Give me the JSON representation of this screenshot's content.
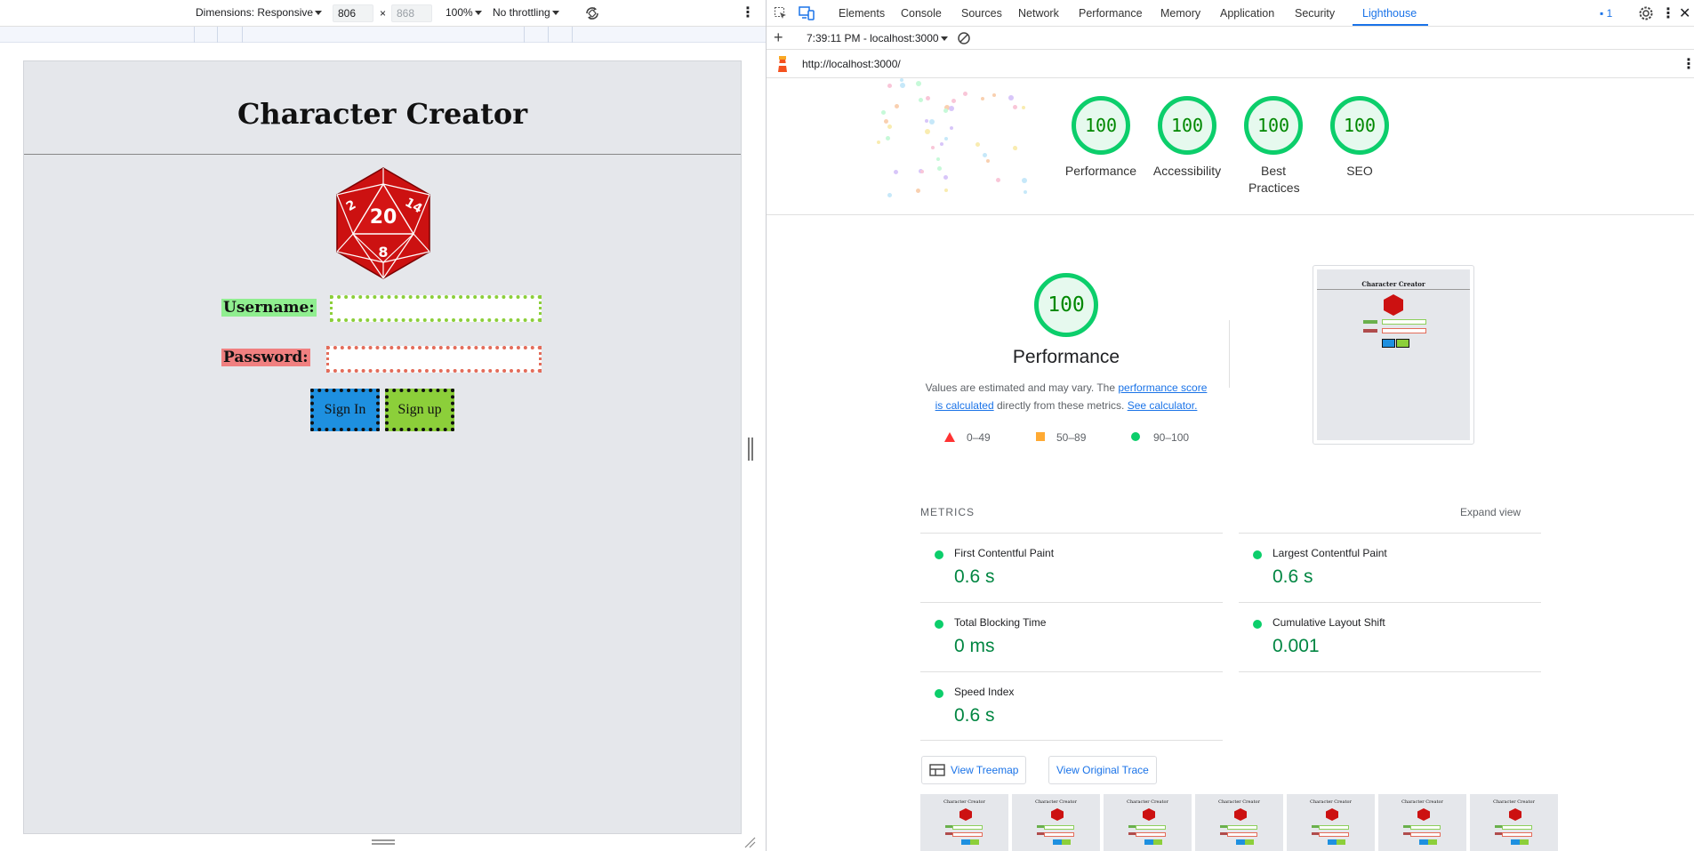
{
  "device_toolbar": {
    "dimensions_label": "Dimensions: Responsive",
    "width": "806",
    "times": "×",
    "height": "868",
    "zoom": "100%",
    "throttling": "No throttling"
  },
  "app": {
    "title": "Character Creator",
    "username_label": "Username:",
    "password_label": "Password:",
    "sign_in_label": "Sign In",
    "sign_up_label": "Sign up",
    "d20_numbers": [
      "20",
      "2",
      "14",
      "8"
    ]
  },
  "devtools": {
    "tabs": [
      "Elements",
      "Console",
      "Sources",
      "Network",
      "Performance",
      "Memory",
      "Application",
      "Security",
      "Lighthouse"
    ],
    "active_tab": "Lighthouse",
    "issues_count": "1",
    "report_selector": "7:39:11 PM - localhost:3000",
    "url": "http://localhost:3000/"
  },
  "lighthouse": {
    "categories": [
      {
        "label": "Performance",
        "score": "100"
      },
      {
        "label": "Accessibility",
        "score": "100"
      },
      {
        "label": "Best Practices",
        "score": "100"
      },
      {
        "label": "SEO",
        "score": "100"
      }
    ],
    "main_score": "100",
    "main_title": "Performance",
    "description_prefix": "Values are estimated and may vary. The ",
    "description_link1": "performance score is calculated",
    "description_middle": " directly from these metrics. ",
    "description_link2": "See calculator.",
    "legend": [
      {
        "range": "0–49",
        "color": "#ff3333",
        "shape": "triangle"
      },
      {
        "range": "50–89",
        "color": "#ffaa33",
        "shape": "square"
      },
      {
        "range": "90–100",
        "color": "#0cce6b",
        "shape": "circle"
      }
    ],
    "metrics_heading": "METRICS",
    "expand_view": "Expand view",
    "metrics": [
      {
        "name": "First Contentful Paint",
        "value": "0.6 s"
      },
      {
        "name": "Largest Contentful Paint",
        "value": "0.6 s"
      },
      {
        "name": "Total Blocking Time",
        "value": "0 ms"
      },
      {
        "name": "Cumulative Layout Shift",
        "value": "0.001"
      },
      {
        "name": "Speed Index",
        "value": "0.6 s"
      }
    ],
    "view_treemap": "View Treemap",
    "view_trace": "View Original Trace",
    "thumbnail_title": "Character Creator"
  },
  "colors": {
    "pass": "#0cce6b",
    "pass_text": "#018642",
    "link": "#1a73e8",
    "username_bg": "#90ee90",
    "password_bg": "#f08080",
    "sign_in_bg": "#1e90e0",
    "sign_up_bg": "#8ccf3a",
    "die_red": "#cc1111"
  }
}
